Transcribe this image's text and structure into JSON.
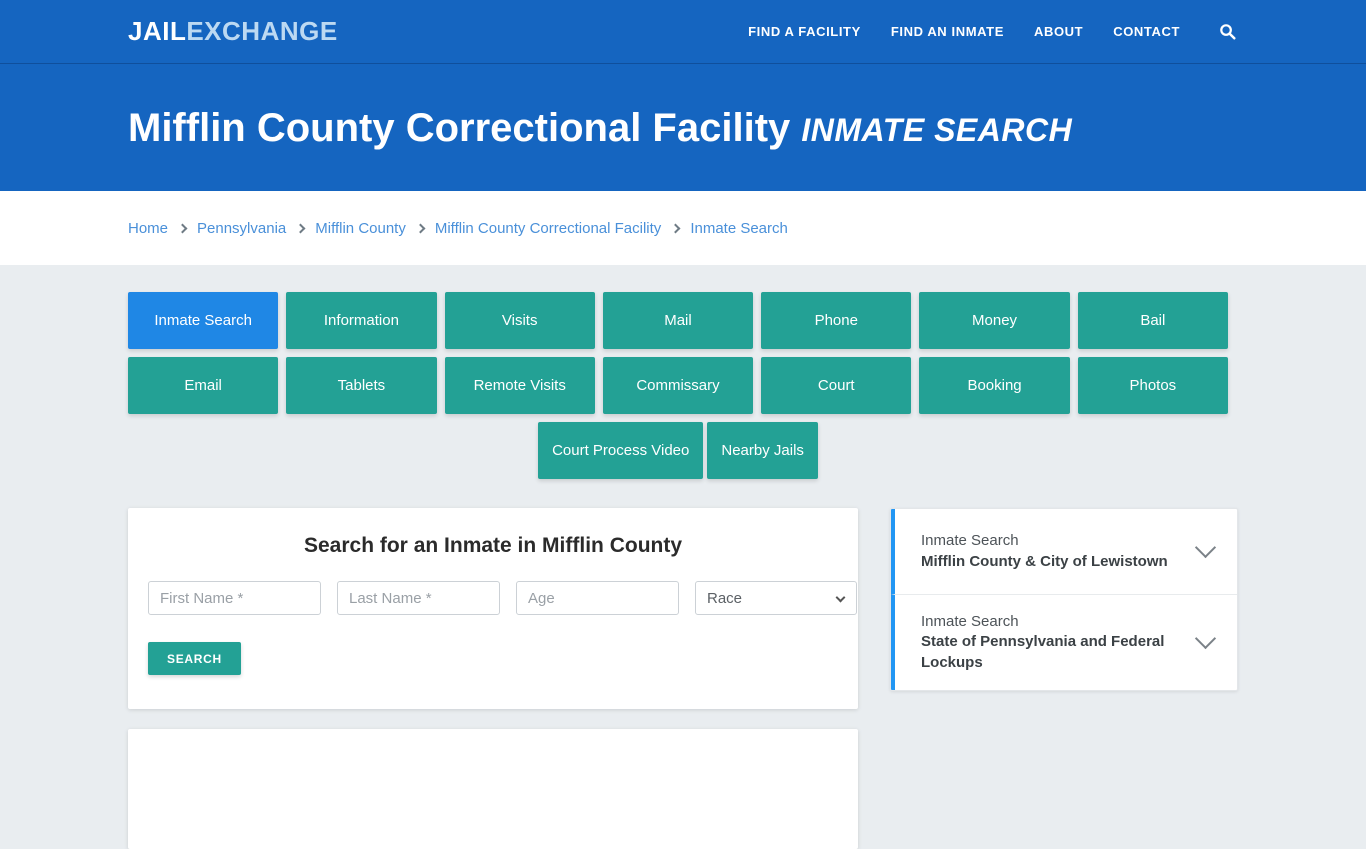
{
  "header": {
    "logo_primary": "JAIL",
    "logo_secondary": "EXCHANGE",
    "nav": [
      {
        "label": "FIND A FACILITY"
      },
      {
        "label": "FIND AN INMATE"
      },
      {
        "label": "ABOUT"
      },
      {
        "label": "CONTACT"
      }
    ],
    "search_icon": "search-icon",
    "accent_blue": "#1565c0"
  },
  "hero": {
    "title": "Mifflin County Correctional Facility",
    "subtitle": "INMATE SEARCH"
  },
  "breadcrumb": {
    "items": [
      {
        "label": "Home"
      },
      {
        "label": "Pennsylvania"
      },
      {
        "label": "Mifflin County"
      },
      {
        "label": "Mifflin County Correctional Facility"
      },
      {
        "label": "Inmate Search"
      }
    ]
  },
  "tabs": {
    "active_color": "#1f87e5",
    "inactive_color": "#23a195",
    "row1": [
      {
        "label": "Inmate Search",
        "active": true
      },
      {
        "label": "Information"
      },
      {
        "label": "Visits"
      },
      {
        "label": "Mail"
      },
      {
        "label": "Phone"
      },
      {
        "label": "Money"
      },
      {
        "label": "Bail"
      }
    ],
    "row2": [
      {
        "label": "Email"
      },
      {
        "label": "Tablets"
      },
      {
        "label": "Remote Visits"
      },
      {
        "label": "Commissary"
      },
      {
        "label": "Court"
      },
      {
        "label": "Booking"
      },
      {
        "label": "Photos"
      }
    ],
    "row3": [
      {
        "label": "Court Process Video"
      },
      {
        "label": "Nearby Jails"
      }
    ]
  },
  "search_form": {
    "title": "Search for an Inmate in Mifflin County",
    "first_name_placeholder": "First Name *",
    "first_name_value": "",
    "last_name_placeholder": "Last Name *",
    "last_name_value": "",
    "age_placeholder": "Age",
    "age_value": "",
    "race_selected": "Race",
    "race_options": [
      "Race"
    ],
    "submit_label": "SEARCH",
    "submit_color": "#23a195"
  },
  "sidebar": {
    "accent_color": "#2196f3",
    "items": [
      {
        "line1": "Inmate Search",
        "line2": "Mifflin County & City of Lewistown",
        "chevron": "chevron-down-icon"
      },
      {
        "line1": "Inmate Search",
        "line2": "State of Pennsylvania and Federal Lockups",
        "chevron": "chevron-down-icon"
      }
    ]
  }
}
